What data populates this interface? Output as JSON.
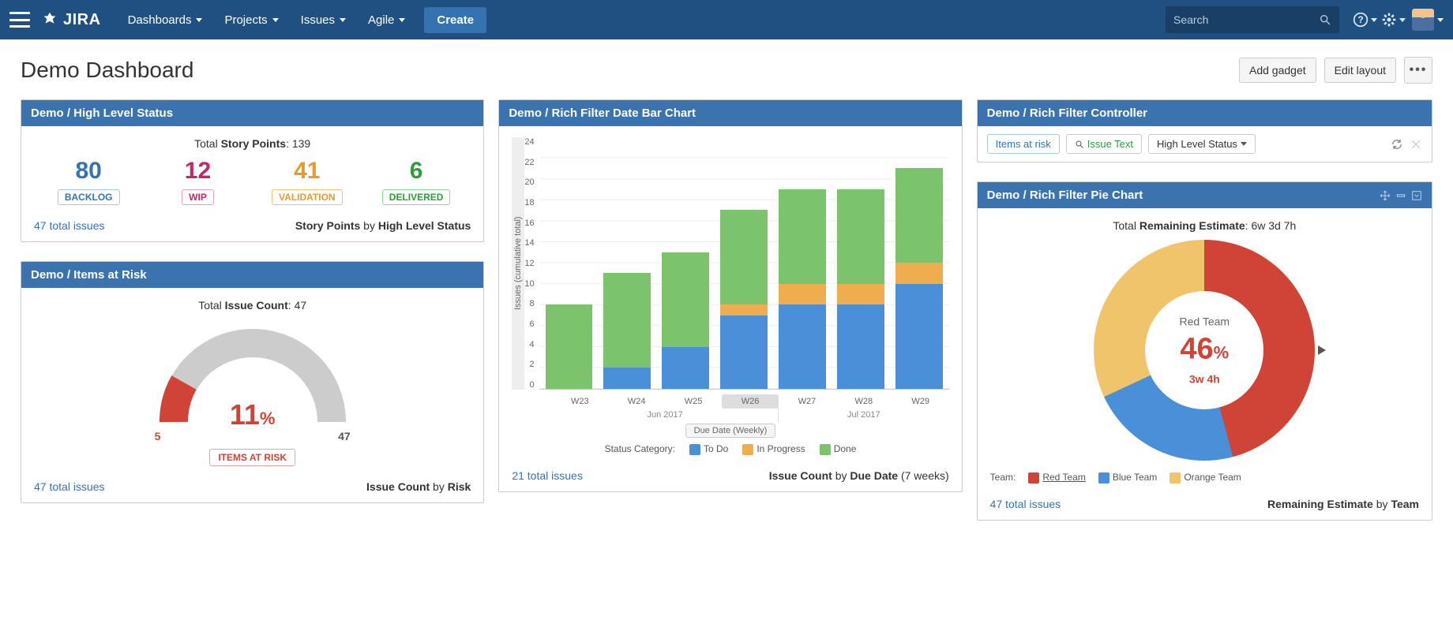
{
  "nav": {
    "logo_text": "JIRA",
    "items": [
      "Dashboards",
      "Projects",
      "Issues",
      "Agile"
    ],
    "create": "Create",
    "search_placeholder": "Search"
  },
  "page": {
    "title": "Demo Dashboard",
    "add_gadget": "Add gadget",
    "edit_layout": "Edit layout"
  },
  "gadgets": {
    "high_level": {
      "title": "Demo / High Level Status",
      "total_label_pre": "Total ",
      "total_label_bold": "Story Points",
      "total_value": "139",
      "statuses": [
        {
          "value": "80",
          "label": "BACKLOG",
          "cls_num": "c-backlog",
          "cls_tag": "t-backlog"
        },
        {
          "value": "12",
          "label": "WIP",
          "cls_num": "c-wip",
          "cls_tag": "t-wip"
        },
        {
          "value": "41",
          "label": "VALIDATION",
          "cls_num": "c-valid",
          "cls_tag": "t-valid"
        },
        {
          "value": "6",
          "label": "DELIVERED",
          "cls_num": "c-deliv",
          "cls_tag": "t-deliv"
        }
      ],
      "footer_link": "47 total issues",
      "footer_right_1": "Story Points",
      "footer_right_mid": " by ",
      "footer_right_2": "High Level Status"
    },
    "items_risk": {
      "title": "Demo / Items at Risk",
      "total_label_pre": "Total ",
      "total_label_bold": "Issue Count",
      "total_value": "47",
      "percent": "11",
      "min": "5",
      "max": "47",
      "tag": "ITEMS AT RISK",
      "footer_link": "47 total issues",
      "footer_right_1": "Issue Count",
      "footer_right_mid": " by ",
      "footer_right_2": "Risk"
    },
    "bar": {
      "title": "Demo / Rich Filter Date Bar Chart",
      "footer_link": "21 total issues",
      "footer_right_1": "Issue Count",
      "footer_right_mid": " by ",
      "footer_right_2": "Due Date",
      "footer_right_suffix": " (7 weeks)",
      "x_axis_label": "Due Date (Weekly)",
      "y_axis_label": "Issues (cumulative total)",
      "legend_label": "Status Category:",
      "legend": [
        "To Do",
        "In Progress",
        "Done"
      ],
      "months": [
        "Jun 2017",
        "Jul 2017"
      ]
    },
    "controller": {
      "title": "Demo / Rich Filter Controller",
      "chip1": "Items at risk",
      "chip2": "Issue Text",
      "chip3": "High Level Status"
    },
    "pie": {
      "title": "Demo / Rich Filter Pie Chart",
      "total_label_pre": "Total ",
      "total_label_bold": "Remaining Estimate",
      "total_value": "6w 3d 7h",
      "center_team": "Red Team",
      "center_pct": "46",
      "center_est": "3w 4h",
      "legend_label": "Team:",
      "legend": [
        "Red Team",
        "Blue Team",
        "Orange Team"
      ],
      "footer_link": "47 total issues",
      "footer_right_1": "Remaining Estimate",
      "footer_right_mid": " by ",
      "footer_right_2": "Team"
    }
  },
  "chart_data": [
    {
      "id": "high_level_status",
      "type": "table",
      "title": "Total Story Points: 139",
      "columns": [
        "Status",
        "Story Points"
      ],
      "rows": [
        [
          "BACKLOG",
          80
        ],
        [
          "WIP",
          12
        ],
        [
          "VALIDATION",
          41
        ],
        [
          "DELIVERED",
          6
        ]
      ]
    },
    {
      "id": "items_at_risk_gauge",
      "type": "gauge",
      "title": "Total Issue Count: 47",
      "min": 0,
      "max": 47,
      "value": 5,
      "percent": 11,
      "label": "ITEMS AT RISK"
    },
    {
      "id": "status_category_stacked_bar",
      "type": "bar",
      "stacked": true,
      "title": "",
      "xlabel": "Due Date (Weekly)",
      "ylabel": "Issues (cumulative total)",
      "ylim": [
        0,
        24
      ],
      "y_ticks": [
        0,
        2,
        4,
        6,
        8,
        10,
        12,
        14,
        16,
        18,
        20,
        22,
        24
      ],
      "categories": [
        "W23",
        "W24",
        "W25",
        "W26",
        "W27",
        "W28",
        "W29"
      ],
      "category_groups": {
        "Jun 2017": [
          "W23",
          "W24",
          "W25",
          "W26"
        ],
        "Jul 2017": [
          "W27",
          "W28",
          "W29"
        ]
      },
      "series": [
        {
          "name": "To Do",
          "color": "#4a90d9",
          "values": [
            0,
            2,
            4,
            7,
            8,
            8,
            10
          ]
        },
        {
          "name": "In Progress",
          "color": "#f0ad4e",
          "values": [
            0,
            0,
            0,
            1,
            2,
            2,
            2
          ]
        },
        {
          "name": "Done",
          "color": "#7bc46b",
          "values": [
            8,
            9,
            9,
            9,
            9,
            9,
            9
          ]
        }
      ]
    },
    {
      "id": "remaining_estimate_donut",
      "type": "pie",
      "title": "Total Remaining Estimate: 6w 3d 7h",
      "series": [
        {
          "name": "Red Team",
          "color": "#d04437",
          "value": 46,
          "label": "3w 4h"
        },
        {
          "name": "Blue Team",
          "color": "#4a90d9",
          "value": 22
        },
        {
          "name": "Orange Team",
          "color": "#f0c46b",
          "value": 32
        }
      ],
      "highlighted": "Red Team"
    }
  ]
}
